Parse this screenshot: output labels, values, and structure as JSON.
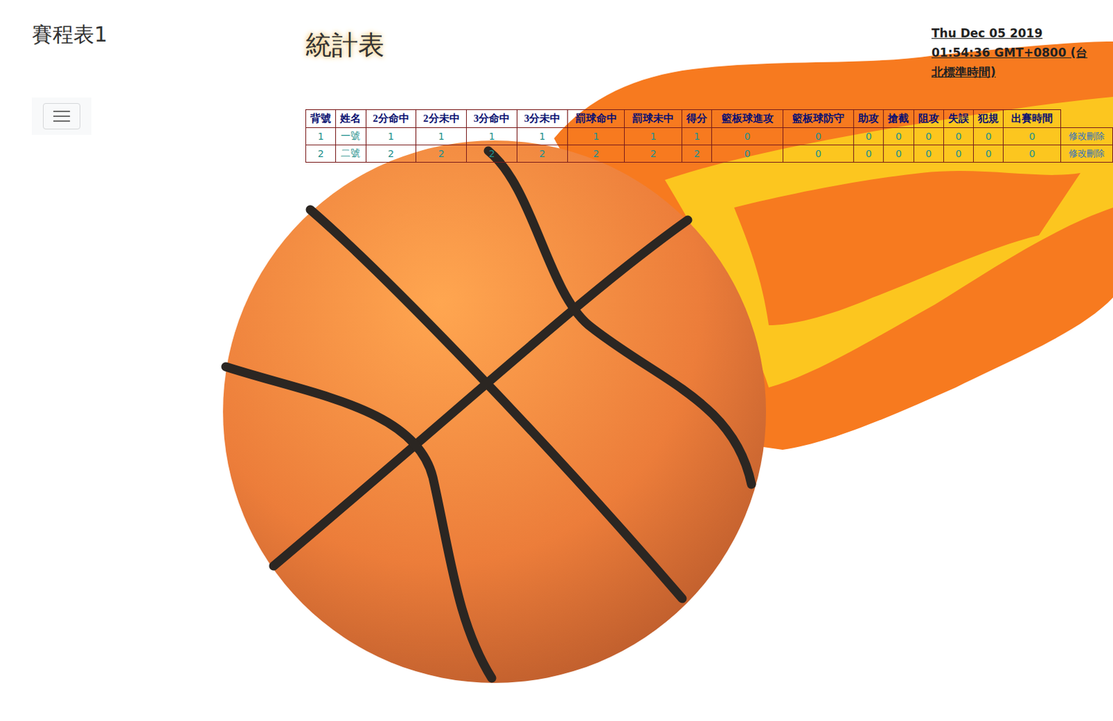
{
  "sidebar": {
    "title": "賽程表1"
  },
  "page_title": "統計表",
  "datetime": "Thu Dec 05 2019 01:54:36 GMT+0800 (台北標準時間)",
  "table": {
    "columns": [
      "背號",
      "姓名",
      "2分命中",
      "2分未中",
      "3分命中",
      "3分未中",
      "罰球命中",
      "罰球未中",
      "得分",
      "籃板球進攻",
      "籃板球防守",
      "助攻",
      "搶截",
      "阻攻",
      "失誤",
      "犯規",
      "出賽時間"
    ],
    "rows": [
      {
        "cells": [
          "1",
          "一號",
          "1",
          "1",
          "1",
          "1",
          "1",
          "1",
          "1",
          "0",
          "0",
          "0",
          "0",
          "0",
          "0",
          "0",
          "0"
        ],
        "actions": [
          "修改",
          "刪除"
        ]
      },
      {
        "cells": [
          "2",
          "二號",
          "2",
          "2",
          "2",
          "2",
          "2",
          "2",
          "2",
          "0",
          "0",
          "0",
          "0",
          "0",
          "0",
          "0",
          "0"
        ],
        "actions": [
          "修改",
          "刪除"
        ]
      }
    ]
  }
}
